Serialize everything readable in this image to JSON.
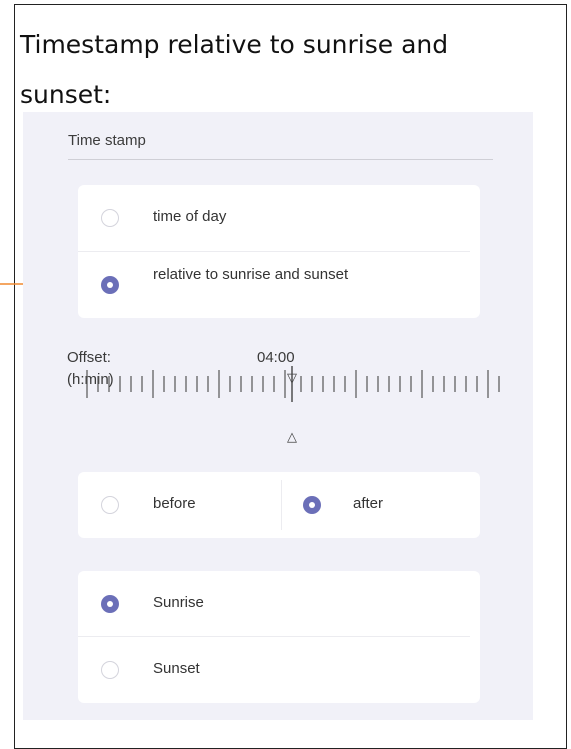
{
  "heading": "Timestamp relative to sunrise and sunset:",
  "section_label": "Time stamp",
  "timestamp_mode": {
    "options": [
      {
        "label": "time of day",
        "selected": false
      },
      {
        "label": "relative to sunrise and sunset",
        "selected": true
      }
    ]
  },
  "offset": {
    "label": "Offset:",
    "unit_label": "(h:min)",
    "value": "04:00",
    "marker_top": "▽",
    "marker_bottom": "△"
  },
  "direction": {
    "options": [
      {
        "label": "before",
        "selected": false
      },
      {
        "label": "after",
        "selected": true
      }
    ]
  },
  "event": {
    "options": [
      {
        "label": "Sunrise",
        "selected": true
      },
      {
        "label": "Sunset",
        "selected": false
      }
    ]
  },
  "colors": {
    "accent": "#6b6fb8",
    "annotation_arrow": "#f0882e",
    "panel_bg": "#f1f1f8"
  }
}
